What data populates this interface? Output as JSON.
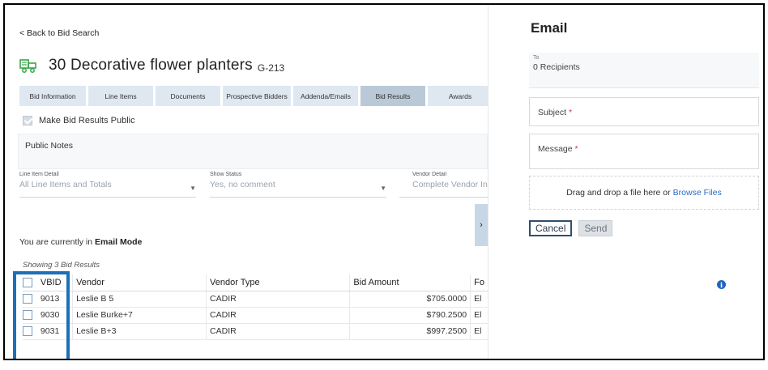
{
  "nav": {
    "back_label": "< Back to Bid Search"
  },
  "bid": {
    "title": "30 Decorative flower planters",
    "code": "G-213",
    "icon": "bid-truck-icon"
  },
  "tabs": [
    {
      "label": "Bid Information"
    },
    {
      "label": "Line Items"
    },
    {
      "label": "Documents"
    },
    {
      "label": "Prospective Bidders"
    },
    {
      "label": "Addenda/Emails"
    },
    {
      "label": "Bid Results",
      "active": true
    },
    {
      "label": "Awards"
    }
  ],
  "settings": {
    "make_public_label": "Make Bid Results Public",
    "public_notes_label": "Public Notes"
  },
  "filters": {
    "line_item": {
      "label": "Line Item Detail",
      "value": "All Line Items and Totals"
    },
    "status": {
      "label": "Show Status",
      "value": "Yes, no comment"
    },
    "vendor": {
      "label": "Vendor Detail",
      "value": "Complete Vendor In"
    }
  },
  "mode": {
    "prefix": "You are currently in",
    "name": "Email Mode"
  },
  "results": {
    "showing": "Showing 3 Bid Results",
    "headers": {
      "vbid": "VBID",
      "vendor": "Vendor",
      "type": "Vendor Type",
      "amount": "Bid Amount",
      "f": "Fo"
    },
    "rows": [
      {
        "vbid": "9013",
        "vendor": "Leslie B 5",
        "type": "CADIR",
        "amount": "$705.0000",
        "f": "El"
      },
      {
        "vbid": "9030",
        "vendor": "Leslie Burke+7",
        "type": "CADIR",
        "amount": "$790.2500",
        "f": "El"
      },
      {
        "vbid": "9031",
        "vendor": "Leslie B+3",
        "type": "CADIR",
        "amount": "$997.2500",
        "f": "El"
      }
    ]
  },
  "email": {
    "title": "Email",
    "to_label": "To",
    "to_value": "0 Recipients",
    "subject_label": "Subject",
    "message_label": "Message",
    "required_mark": "*",
    "drop_text": "Drag and drop a file here or",
    "browse_label": "Browse Files",
    "cancel_label": "Cancel",
    "send_label": "Send"
  },
  "colors": {
    "accent": "#1d6fb8",
    "tab": "#dfe8f1",
    "tab_active": "#b9c9d8",
    "required": "#d9363e",
    "link": "#2b6cc4"
  }
}
